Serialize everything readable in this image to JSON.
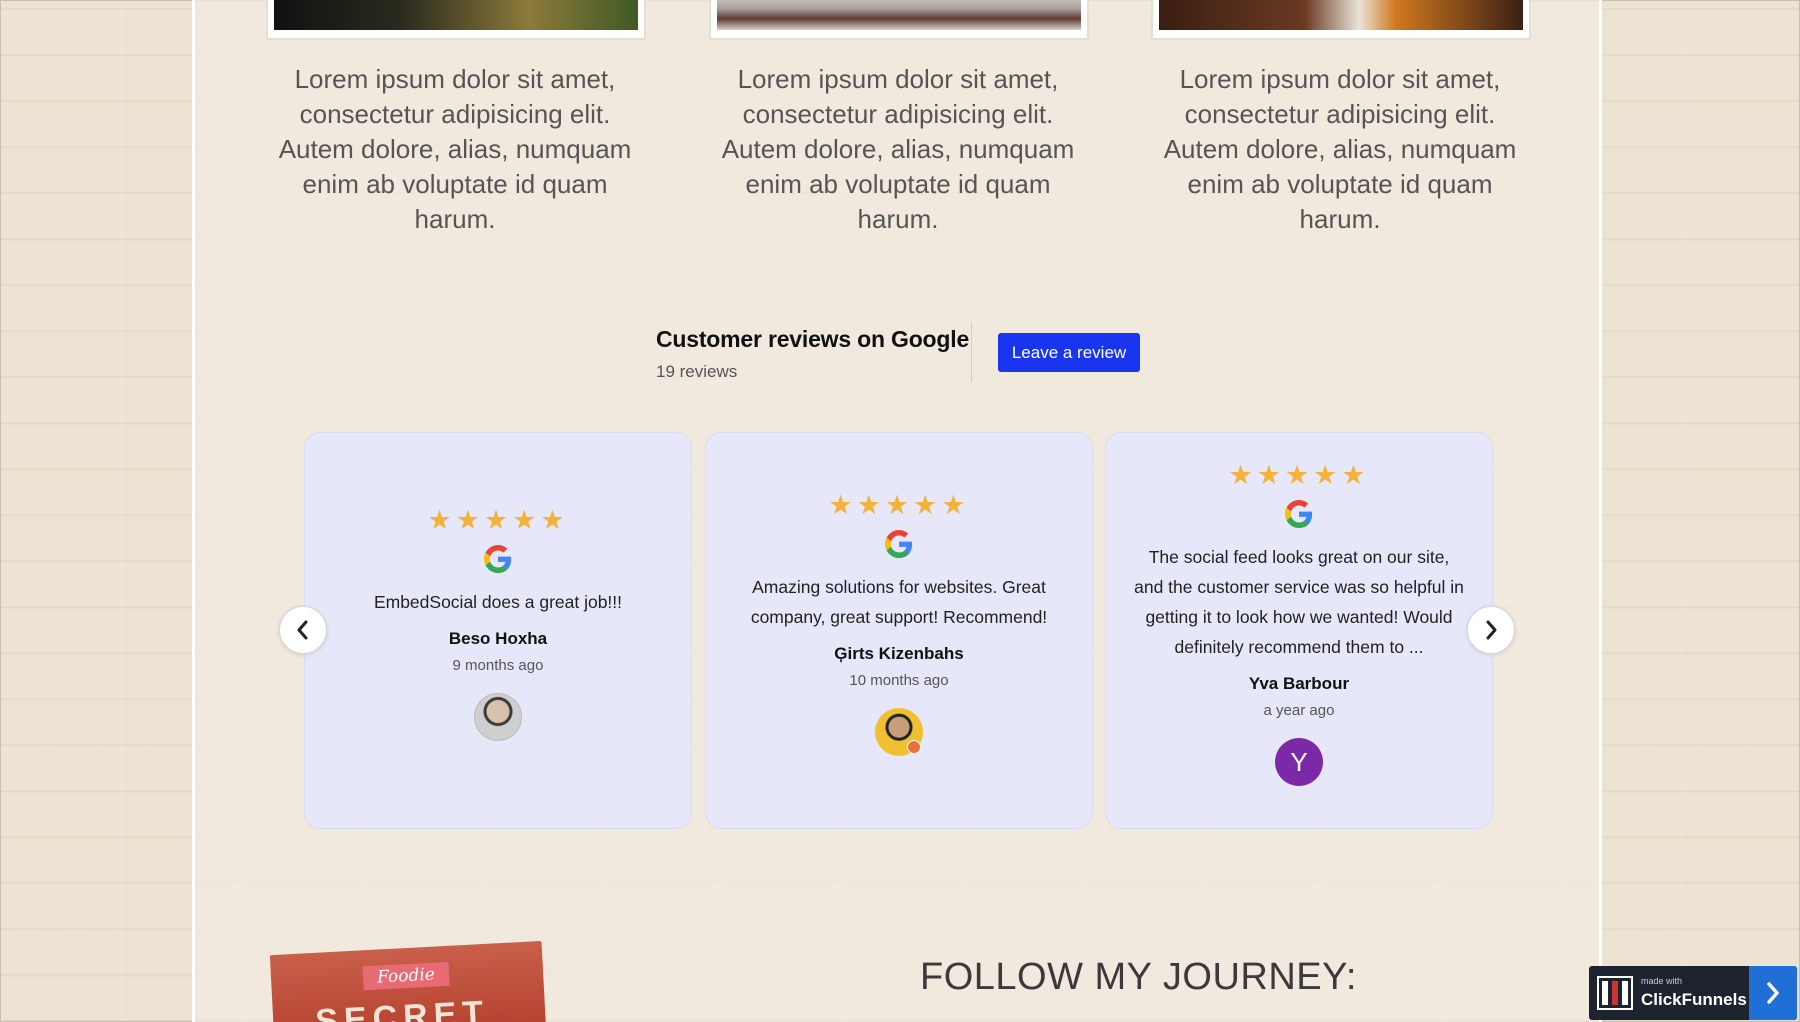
{
  "features": [
    {
      "text": "Lorem ipsum dolor sit amet, consectetur adipisicing elit. Autem dolore, alias, numquam enim ab voluptate id quam harum."
    },
    {
      "text": "Lorem ipsum dolor sit amet, consectetur adipisicing elit. Autem dolore, alias, numquam enim ab voluptate id quam harum."
    },
    {
      "text": "Lorem ipsum dolor sit amet, consectetur adipisicing elit. Autem dolore, alias, numquam enim ab voluptate id quam harum."
    }
  ],
  "reviews_widget": {
    "title": "Customer reviews on Google",
    "count_label": "19 reviews",
    "leave_review_label": "Leave a review",
    "star_color": "#f4b23a",
    "button_color": "#1a35f0",
    "prev_icon": "chevron-left-icon",
    "next_icon": "chevron-right-icon",
    "reviews": [
      {
        "stars": "★★★★★",
        "rating": 5,
        "source_icon": "google-icon",
        "text": "EmbedSocial does a great job!!!",
        "author": "Beso Hoxha",
        "time": "9 months ago"
      },
      {
        "stars": "★★★★★",
        "rating": 5,
        "source_icon": "google-icon",
        "text": "Amazing solutions for websites. Great company, great support! Recommend!",
        "author": "Ģirts Kizenbahs",
        "time": "10 months ago"
      },
      {
        "stars": "★★★★★",
        "rating": 5,
        "source_icon": "google-icon",
        "text": "The social feed looks great on our site, and the customer service was so helpful in getting it to look how we wanted! Would definitely recommend them to ...",
        "author": "Yva Barbour",
        "time": "a year ago",
        "avatar_initial": "Y",
        "avatar_color": "#7a2aa6"
      }
    ]
  },
  "journey": {
    "title": "FOLLOW MY JOURNEY:"
  },
  "book": {
    "label": "Foodie",
    "word": "SECRET"
  },
  "badge": {
    "made_with": "made with",
    "name": "ClickFunnels",
    "accent": "#1f6fd6"
  }
}
